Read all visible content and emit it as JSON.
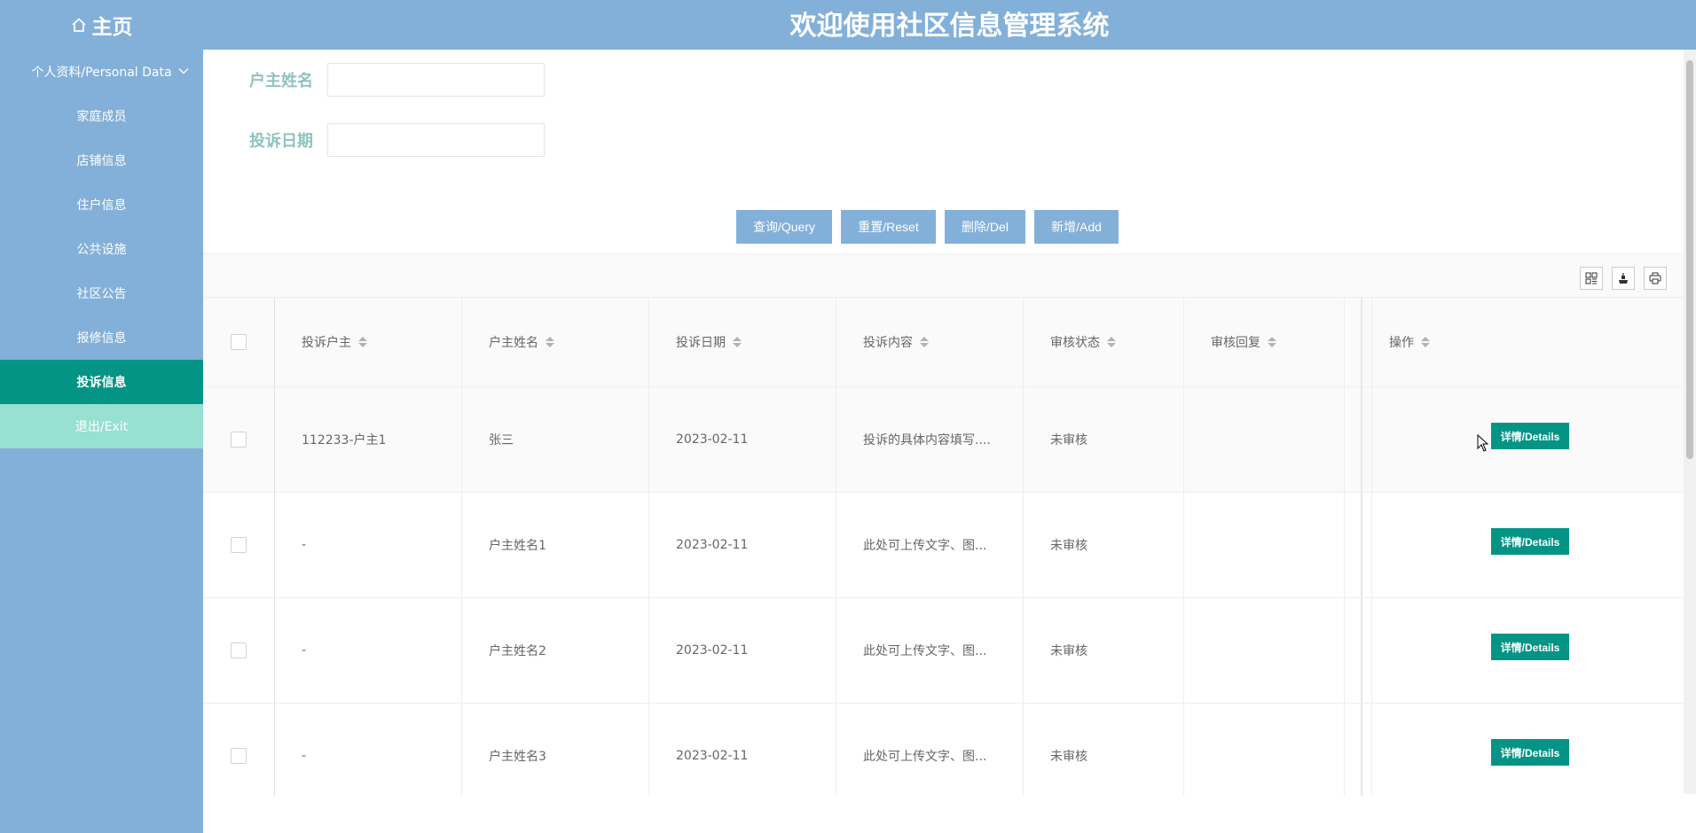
{
  "header": {
    "home_label": "主页",
    "system_title": "欢迎使用社区信息管理系统"
  },
  "sidebar": {
    "parent": "个人资料/Personal Data",
    "items": [
      {
        "label": "家庭成员"
      },
      {
        "label": "店铺信息"
      },
      {
        "label": "住户信息"
      },
      {
        "label": "公共设施"
      },
      {
        "label": "社区公告"
      },
      {
        "label": "报修信息"
      },
      {
        "label": "投诉信息"
      },
      {
        "label": "退出/Exit"
      }
    ]
  },
  "search": {
    "owner_name_label": "户主姓名",
    "owner_name_value": "",
    "complaint_date_label": "投诉日期",
    "complaint_date_value": ""
  },
  "buttons": {
    "query": "查询/Query",
    "reset": "重置/Reset",
    "delete": "删除/Del",
    "add": "新增/Add"
  },
  "table": {
    "columns": [
      "投诉户主",
      "户主姓名",
      "投诉日期",
      "投诉内容",
      "审核状态",
      "审核回复",
      "操作"
    ],
    "rows": [
      {
        "owner": "112233-户主1",
        "name": "张三",
        "date": "2023-02-11",
        "content": "投诉的具体内容填写....",
        "status": "未审核",
        "reply": "",
        "action": "详情/Details"
      },
      {
        "owner": "-",
        "name": "户主姓名1",
        "date": "2023-02-11",
        "content": "此处可上传文字、图...",
        "status": "未审核",
        "reply": "",
        "action": "详情/Details"
      },
      {
        "owner": "-",
        "name": "户主姓名2",
        "date": "2023-02-11",
        "content": "此处可上传文字、图...",
        "status": "未审核",
        "reply": "",
        "action": "详情/Details"
      },
      {
        "owner": "-",
        "name": "户主姓名3",
        "date": "2023-02-11",
        "content": "此处可上传文字、图...",
        "status": "未审核",
        "reply": "",
        "action": "详情/Details"
      }
    ]
  },
  "colors": {
    "primary": "#83b0d9",
    "active": "#039485",
    "exit": "#97e0d2",
    "label": "#8fc3be"
  },
  "icons": [
    "home-icon",
    "chevron-down-icon",
    "columns-icon",
    "export-icon",
    "print-icon",
    "mouse-cursor-icon"
  ]
}
